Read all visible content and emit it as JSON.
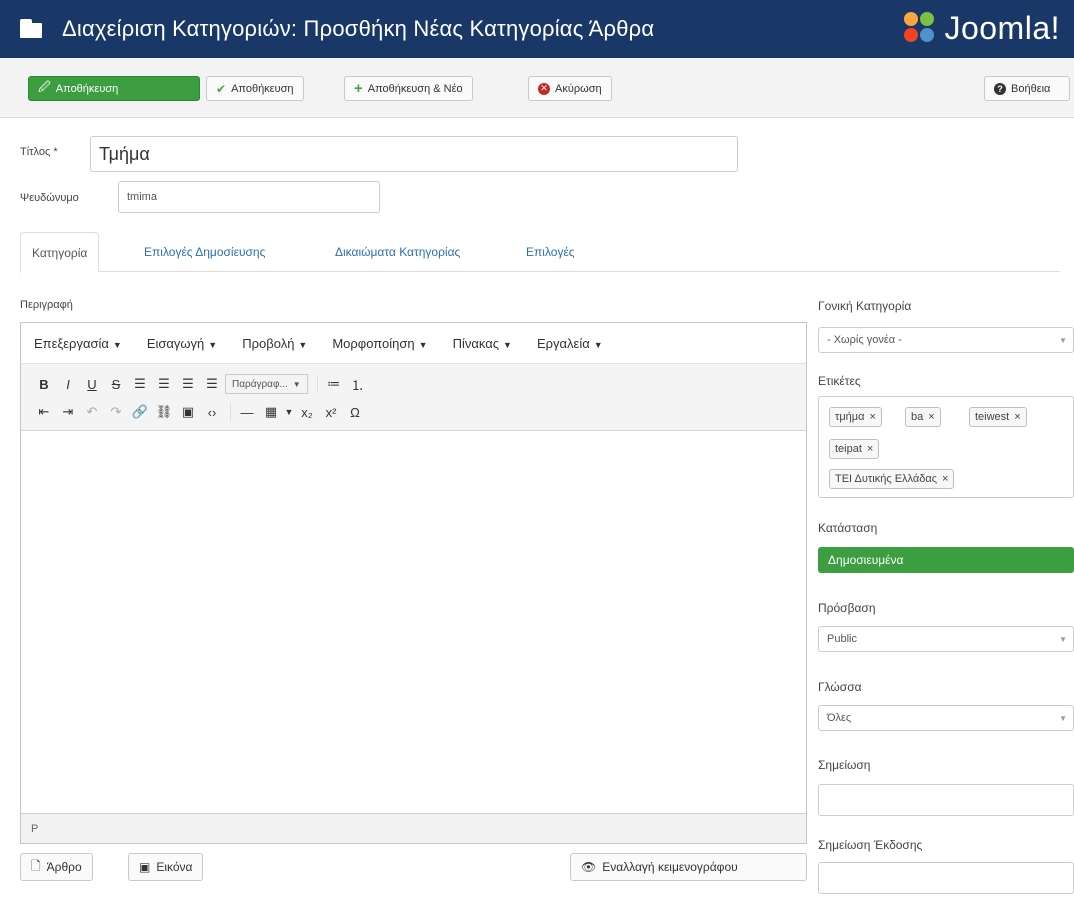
{
  "header": {
    "title": "Διαχείριση Κατηγοριών: Προσθήκη Νέας Κατηγορίας Άρθρα",
    "logo": "Joomla!"
  },
  "toolbar": {
    "save": "Αποθήκευση",
    "save_close": "Αποθήκευση",
    "save_new": "Αποθήκευση & Νέο",
    "cancel": "Ακύρωση",
    "help": "Βοήθεια"
  },
  "form": {
    "title_label": "Τίτλος *",
    "title_value": "Τμήμα",
    "alias_label": "Ψευδώνυμο",
    "alias_value": "tmima"
  },
  "tabs": [
    {
      "label": "Κατηγορία"
    },
    {
      "label": "Επιλογές Δημοσίευσης"
    },
    {
      "label": "Δικαιώματα Κατηγορίας"
    },
    {
      "label": "Επιλογές"
    }
  ],
  "editor": {
    "label": "Περιγραφή",
    "menus": [
      "Επεξεργασία",
      "Εισαγωγή",
      "Προβολή",
      "Μορφοποίηση",
      "Πίνακας",
      "Εργαλεία"
    ],
    "format_select": "Παράγραφ...",
    "status_path": "P",
    "btn_article": "Άρθρο",
    "btn_image": "Εικόνα",
    "btn_toggle": "Εναλλαγή κειμενογράφου"
  },
  "sidebar": {
    "parent_label": "Γονική Κατηγορία",
    "parent_value": "- Χωρίς γονέα -",
    "tags_label": "Ετικέτες",
    "tags": [
      "τμήμα",
      "ba",
      "teiwest",
      "teipat",
      "ΤΕΙ Δυτικής Ελλάδας"
    ],
    "status_label": "Κατάσταση",
    "status_value": "Δημοσιευμένα",
    "access_label": "Πρόσβαση",
    "access_value": "Public",
    "language_label": "Γλώσσα",
    "language_value": "Όλες",
    "note_label": "Σημείωση",
    "version_note_label": "Σημείωση Έκδοσης"
  },
  "colors": {
    "header": "#1a3867",
    "green": "#3d9e41",
    "link": "#2a6fb4",
    "cancel": "#c52827"
  }
}
